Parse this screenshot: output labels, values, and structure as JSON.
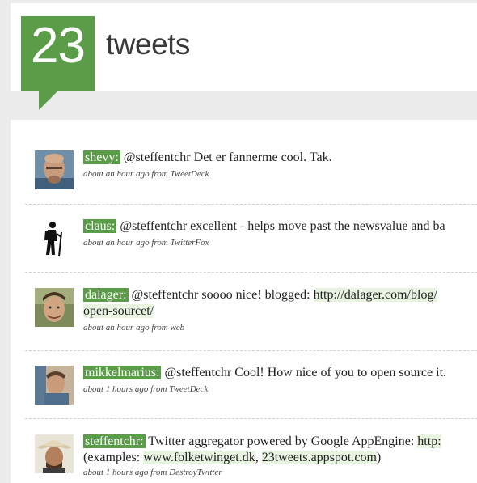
{
  "header": {
    "logo_number": "23",
    "title": "tweets"
  },
  "tweets": [
    {
      "user": "shevy:",
      "text_parts": [
        "@steffentchr Det er fannerme cool. Tak."
      ],
      "meta": "about an hour ago from TweetDeck"
    },
    {
      "user": "claus:",
      "text_parts": [
        "@steffentchr excellent - helps move past the newsvalue and ba"
      ],
      "meta": "about an hour ago from TwitterFox"
    },
    {
      "user": "dalager:",
      "text_before_link": "@steffentchr soooo nice! blogged: ",
      "link_line1": "http://dalager.com/blog/",
      "link_line2": "open-sourcet/",
      "meta": "about an hour ago from web"
    },
    {
      "user": "mikkelmarius:",
      "text_parts": [
        "@steffentchr Cool! How nice of you to open source it."
      ],
      "meta": "about 1 hours ago from TweetDeck"
    },
    {
      "user": "steffentchr:",
      "text_line1": "Twitter aggregator powered by Google AppEngine: ",
      "link1": "http:",
      "line2_prefix": "(examples: ",
      "link2": "www.folketwinget.dk",
      "line2_mid": ", ",
      "link3": "23tweets.appspot.com",
      "line2_suffix": ")",
      "meta": "about 1 hours ago from DestroyTwitter"
    }
  ],
  "colors": {
    "brand_green": "#5a9c48",
    "link_highlight": "#e8f3e1",
    "page_bg": "#ececec"
  }
}
